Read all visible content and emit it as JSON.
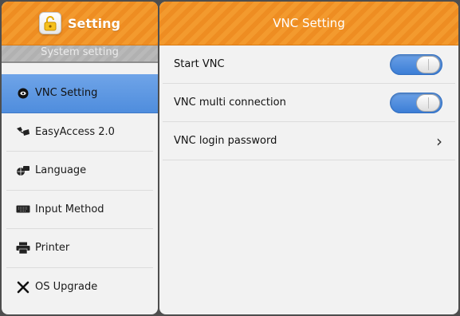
{
  "sidebar": {
    "title": "Setting",
    "subtitle": "System setting",
    "items": [
      {
        "label": "VNC Setting",
        "icon": "vnc-icon",
        "active": true
      },
      {
        "label": "EasyAccess 2.0",
        "icon": "easyaccess-icon",
        "active": false
      },
      {
        "label": "Language",
        "icon": "language-icon",
        "active": false
      },
      {
        "label": "Input Method",
        "icon": "keyboard-icon",
        "active": false
      },
      {
        "label": "Printer",
        "icon": "printer-icon",
        "active": false
      },
      {
        "label": "OS Upgrade",
        "icon": "tools-icon",
        "active": false
      }
    ]
  },
  "main": {
    "title": "VNC Setting",
    "rows": [
      {
        "label": "Start VNC",
        "control": "toggle",
        "state": "on"
      },
      {
        "label": "VNC multi connection",
        "control": "toggle",
        "state": "on"
      },
      {
        "label": "VNC login password",
        "control": "chevron"
      }
    ]
  },
  "colors": {
    "header_orange": "#f39a2e",
    "active_blue": "#5a94e0",
    "toggle_blue": "#4a86d9"
  }
}
